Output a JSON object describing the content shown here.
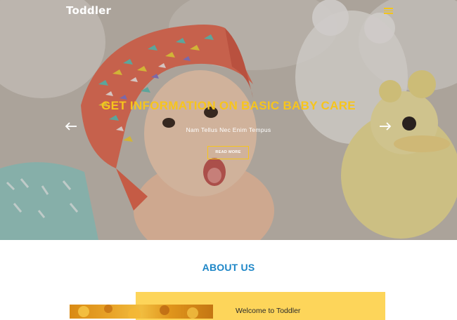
{
  "brand": {
    "name": "Toddler"
  },
  "nav": {
    "menu_icon": "hamburger-menu-icon"
  },
  "hero": {
    "title": "GET INFORMATION ON BASIC BABY CARE",
    "subtitle": "Nam Tellus Nec Enim Tempus",
    "button_label": "READ MORE",
    "prev_icon": "arrow-left-icon",
    "next_icon": "arrow-right-icon"
  },
  "about": {
    "heading": "ABOUT US",
    "welcome": "Welcome to Toddler"
  },
  "colors": {
    "accent_yellow": "#f7c51c",
    "heading_blue": "#1d86c7",
    "panel_yellow": "#fdd55a"
  }
}
